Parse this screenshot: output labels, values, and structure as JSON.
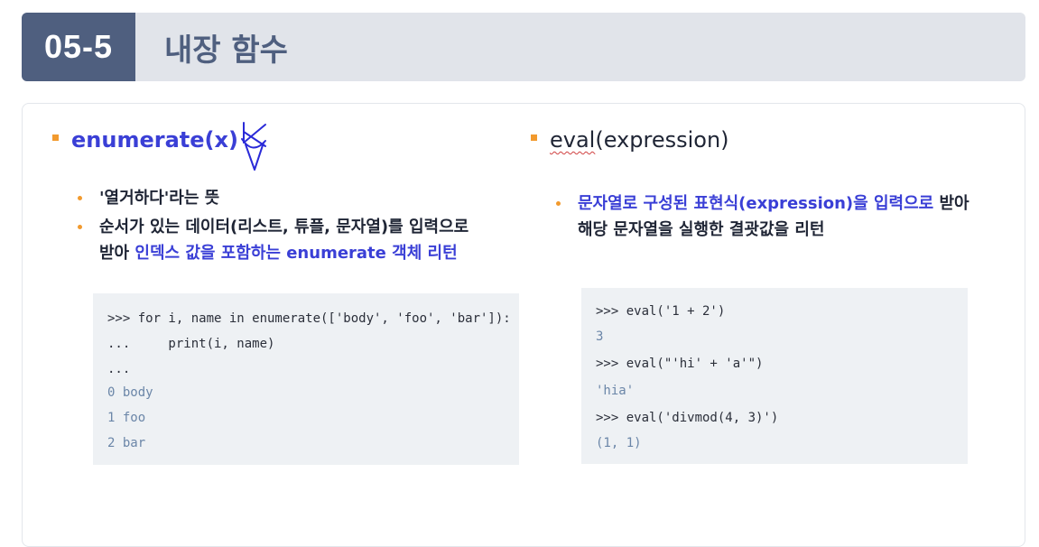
{
  "header": {
    "number": "05-5",
    "title": "내장 함수"
  },
  "left": {
    "heading": "enumerate(x)",
    "bullets": [
      {
        "text": "'열거하다'라는 뜻"
      },
      {
        "line1": "순서가 있는 데이터(리스트, 튜플, 문자열)를 입력으로",
        "line2_plain": "받아 ",
        "line2_highlight": "인덱스 값을 포함하는 enumerate 객체 리턴"
      }
    ],
    "code": [
      {
        "text": ">>> for i, name in enumerate(['body', 'foo', 'bar']):",
        "kind": "in"
      },
      {
        "text": "...     print(i, name)",
        "kind": "in"
      },
      {
        "text": "...",
        "kind": "in"
      },
      {
        "text": "0 body",
        "kind": "out"
      },
      {
        "text": "1 foo",
        "kind": "out"
      },
      {
        "text": "2 bar",
        "kind": "out"
      }
    ]
  },
  "right": {
    "heading_eval": "eval",
    "heading_rest": "(expression)",
    "bullet": {
      "highlight": "문자열로 구성된 표현식(expression)을 입력으로",
      "plain1": " 받아",
      "line2": "해당 문자열을 실행한 결괏값을 리턴"
    },
    "code": [
      {
        "text": ">>> eval('1 + 2')",
        "kind": "in"
      },
      {
        "text": "3",
        "kind": "out"
      },
      {
        "text": ">>> eval(\"'hi' + 'a'\")",
        "kind": "in"
      },
      {
        "text": "'hia'",
        "kind": "out"
      },
      {
        "text": ">>> eval('divmod(4, 3)')",
        "kind": "in"
      },
      {
        "text": "(1, 1)",
        "kind": "out"
      }
    ]
  },
  "colors": {
    "accent": "#3a3fd6",
    "header_bg": "#4f5f7f",
    "bullet": "#f29a2e"
  }
}
